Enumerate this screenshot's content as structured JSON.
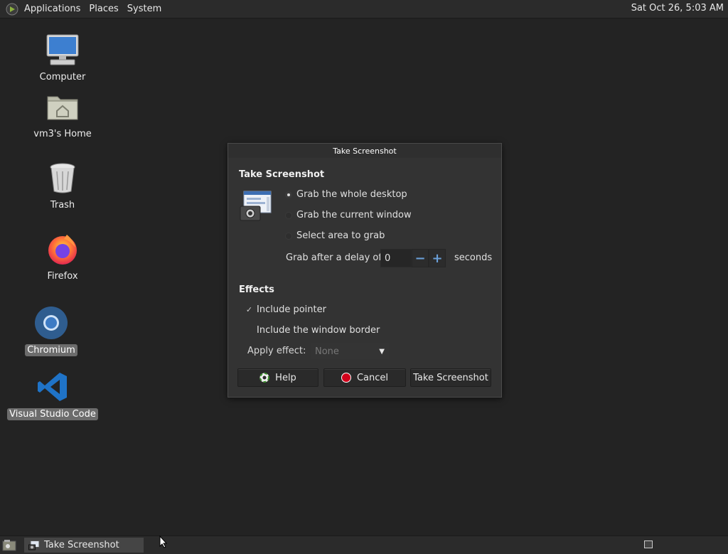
{
  "top_panel": {
    "menus": [
      "Applications",
      "Places",
      "System"
    ],
    "clock": "Sat Oct 26,  5:03 AM"
  },
  "desktop": {
    "icons": [
      {
        "label": "Computer",
        "icon": "computer-icon"
      },
      {
        "label": "vm3's Home",
        "icon": "home-folder-icon"
      },
      {
        "label": "Trash",
        "icon": "trash-icon"
      },
      {
        "label": "Firefox",
        "icon": "firefox-icon"
      },
      {
        "label": "Chromium",
        "icon": "chromium-icon"
      },
      {
        "label": "Visual Studio Code",
        "icon": "vscode-icon"
      }
    ]
  },
  "dialog": {
    "title": "Take Screenshot",
    "heading": "Take Screenshot",
    "options": {
      "whole_desktop": "Grab the whole desktop",
      "current_window": "Grab the current window",
      "select_area": "Select area to grab",
      "selected": "whole_desktop"
    },
    "delay": {
      "label": "Grab after a delay of",
      "value": "0",
      "unit": "seconds"
    },
    "effects": {
      "heading": "Effects",
      "include_pointer": "Include pointer",
      "include_pointer_checked": true,
      "include_border": "Include the window border",
      "include_border_checked": false,
      "apply_effect_label": "Apply effect:",
      "apply_effect_value": "None"
    },
    "buttons": {
      "help": "Help",
      "cancel": "Cancel",
      "take": "Take Screenshot"
    }
  },
  "bottom_panel": {
    "task": "Take Screenshot"
  },
  "colors": {
    "desktop_bg": "#232323",
    "dialog_bg": "#333333",
    "accent_blue": "#6a9fd8",
    "cancel_red": "#d0021b"
  }
}
